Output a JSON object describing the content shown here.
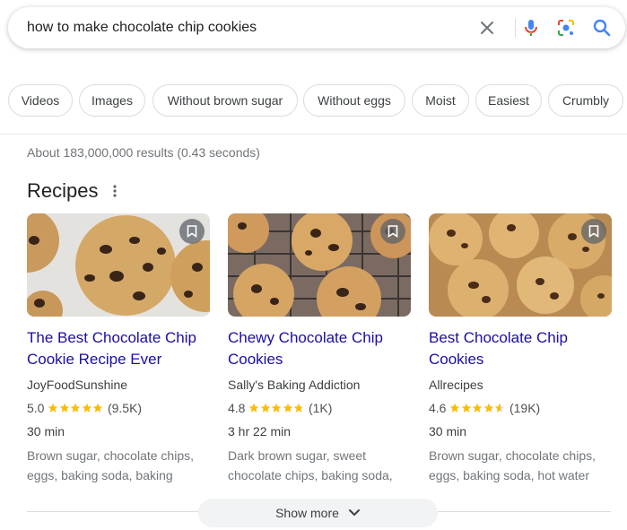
{
  "search": {
    "query": "how to make chocolate chip cookies"
  },
  "chips": [
    "Videos",
    "Images",
    "Without brown sugar",
    "Without eggs",
    "Moist",
    "Easiest",
    "Crumbly"
  ],
  "stats": "About 183,000,000 results (0.43 seconds)",
  "recipes": {
    "title": "Recipes",
    "cards": [
      {
        "title": "The Best Chocolate Chip Cookie Recipe Ever",
        "source": "JoyFoodSunshine",
        "rating": "5.0",
        "stars": 5,
        "reviews": "(9.5K)",
        "time": "30 min",
        "ingredients": "Brown sugar, chocolate chips, eggs, baking soda, baking"
      },
      {
        "title": "Chewy Chocolate Chip Cookies",
        "source": "Sally's Baking Addiction",
        "rating": "4.8",
        "stars": 4.8,
        "reviews": "(1K)",
        "time": "3 hr 22 min",
        "ingredients": "Dark brown sugar, sweet chocolate chips, baking soda,"
      },
      {
        "title": "Best Chocolate Chip Cookies",
        "source": "Allrecipes",
        "rating": "4.6",
        "stars": 4.6,
        "reviews": "(19K)",
        "time": "30 min",
        "ingredients": "Brown sugar, chocolate chips, eggs, baking soda, hot water"
      }
    ]
  },
  "show_more": "Show more",
  "colors": {
    "link": "#1a0dab",
    "star": "#fbbc04",
    "blue": "#4285f4",
    "red": "#ea4335",
    "yellow": "#fbbc05",
    "green": "#34a853"
  }
}
